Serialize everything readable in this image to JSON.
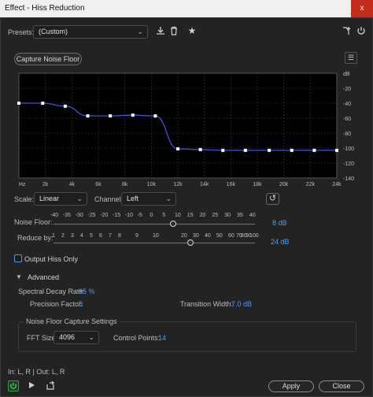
{
  "window": {
    "title": "Effect - Hiss Reduction",
    "close_label": "x"
  },
  "presets": {
    "label": "Presets:",
    "value": "(Custom)"
  },
  "capture": {
    "label": "Capture Noise Floor"
  },
  "graph": {
    "db_labels": [
      "dB",
      "-20",
      "-40",
      "-60",
      "-80",
      "-100",
      "-120",
      "-140"
    ],
    "hz_labels": [
      "Hz",
      "2k",
      "4k",
      "6k",
      "8k",
      "10k",
      "12k",
      "14k",
      "16k",
      "18k",
      "20k",
      "22k",
      "24k"
    ],
    "points_khz": [
      0,
      2,
      4,
      6,
      8,
      10,
      12,
      14,
      16,
      18,
      20,
      22,
      24
    ],
    "curve_color": "#3f4fd8",
    "points": [
      {
        "hz": 0,
        "db": -40
      },
      {
        "hz": 1800,
        "db": -40
      },
      {
        "hz": 3500,
        "db": -44
      },
      {
        "hz": 5200,
        "db": -57
      },
      {
        "hz": 6900,
        "db": -57
      },
      {
        "hz": 8600,
        "db": -56
      },
      {
        "hz": 10300,
        "db": -57
      },
      {
        "hz": 12000,
        "db": -101
      },
      {
        "hz": 13700,
        "db": -102
      },
      {
        "hz": 15400,
        "db": -103
      },
      {
        "hz": 17100,
        "db": -103
      },
      {
        "hz": 18900,
        "db": -103
      },
      {
        "hz": 20600,
        "db": -103
      },
      {
        "hz": 22300,
        "db": -103
      },
      {
        "hz": 24000,
        "db": -103
      }
    ]
  },
  "scale": {
    "label": "Scale:",
    "value": "Linear"
  },
  "channel": {
    "label": "Channel:",
    "value": "Left"
  },
  "noise_floor": {
    "label": "Noise Floor:",
    "ticks": [
      "-40",
      "-35",
      "-30",
      "-25",
      "-20",
      "-15",
      "-10",
      "-5",
      "0",
      "5",
      "10",
      "15",
      "20",
      "25",
      "30",
      "35",
      "40"
    ],
    "value": "8",
    "unit": "dB"
  },
  "reduce_by": {
    "label": "Reduce by:",
    "ticks": [
      "1",
      "2",
      "3",
      "4",
      "5",
      "6",
      "7",
      "8",
      "9",
      "10",
      "20",
      "30",
      "40",
      "50",
      "60",
      "70",
      "80",
      "90",
      "100"
    ],
    "value": "24",
    "unit": "dB"
  },
  "output_hiss": {
    "label": "Output Hiss Only"
  },
  "advanced": {
    "label": "Advanced",
    "spectral_decay": {
      "label": "Spectral Decay Rate:",
      "value": "65",
      "unit": "%"
    },
    "precision": {
      "label": "Precision Factor:",
      "value": "5"
    },
    "transition": {
      "label": "Transition Width:",
      "value": "7.0",
      "unit": "dB"
    }
  },
  "capture_settings": {
    "label": "Noise Floor Capture Settings",
    "fft_label": "FFT Size:",
    "fft_value": "4096",
    "control_points_label": "Control Points:",
    "control_points_value": "14"
  },
  "io": "In: L, R | Out: L, R",
  "buttons": {
    "apply": "Apply",
    "close": "Close"
  },
  "accent": "#4b9cf5"
}
